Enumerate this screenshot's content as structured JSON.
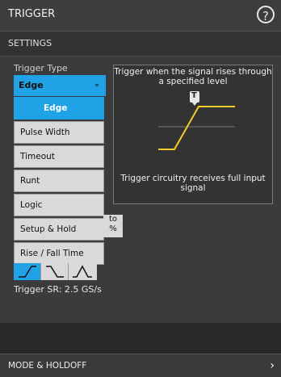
{
  "header": {
    "title": "TRIGGER",
    "help_icon": "help-circle-icon"
  },
  "section": {
    "label": "SETTINGS"
  },
  "trigger_type": {
    "label": "Trigger Type",
    "selected": "Edge",
    "options": [
      "Edge",
      "Pulse Width",
      "Timeout",
      "Runt",
      "Logic",
      "Setup & Hold",
      "Rise / Fall Time"
    ],
    "selected_index": 0
  },
  "info_box": {
    "top_text": "Trigger when the signal rises through a specified level",
    "bottom_text": "Trigger circuitry receives full input signal",
    "marker": "T"
  },
  "partial_label": "to\n%",
  "slope": {
    "options": [
      "rising-edge-icon",
      "falling-edge-icon",
      "either-edge-icon"
    ],
    "selected_index": 0
  },
  "sample_rate": {
    "text": "Trigger SR: 2.5 GS/s"
  },
  "footer": {
    "label": "MODE & HOLDOFF"
  },
  "colors": {
    "accent": "#1fa3e6",
    "trace": "#f2cc2a"
  }
}
